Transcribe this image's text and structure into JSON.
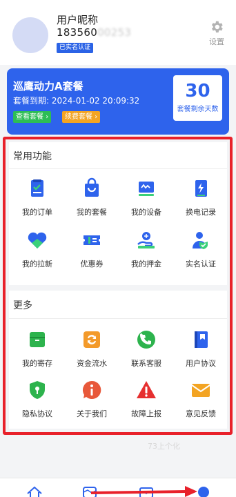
{
  "profile": {
    "nickname": "用户昵称",
    "phone_visible": "183560",
    "phone_obscured": "00253",
    "verified_badge": "已实名认证",
    "settings_label": "设置"
  },
  "package": {
    "name": "巡鹰动力A套餐",
    "expire_text": "套餐到期: 2024-01-02 20:09:32",
    "view_button": "查看套餐",
    "renew_button": "续费套餐",
    "days_remaining": "30",
    "days_label": "套餐剩余天数"
  },
  "common_functions": {
    "title": "常用功能",
    "items": [
      {
        "label": "我的订单",
        "icon": "order-icon"
      },
      {
        "label": "我的套餐",
        "icon": "package-bag-icon"
      },
      {
        "label": "我的设备",
        "icon": "device-icon"
      },
      {
        "label": "换电记录",
        "icon": "battery-swap-icon"
      },
      {
        "label": "我的拉新",
        "icon": "heart-icon"
      },
      {
        "label": "优惠券",
        "icon": "coupon-icon"
      },
      {
        "label": "我的押金",
        "icon": "deposit-icon"
      },
      {
        "label": "实名认证",
        "icon": "user-verify-icon"
      }
    ]
  },
  "more": {
    "title": "更多",
    "items": [
      {
        "label": "我的寄存",
        "icon": "storage-icon"
      },
      {
        "label": "资金流水",
        "icon": "transactions-icon"
      },
      {
        "label": "联系客服",
        "icon": "phone-icon"
      },
      {
        "label": "用户协议",
        "icon": "agreement-icon"
      },
      {
        "label": "隐私协议",
        "icon": "privacy-shield-icon"
      },
      {
        "label": "关于我们",
        "icon": "info-icon"
      },
      {
        "label": "故障上报",
        "icon": "warning-icon"
      },
      {
        "label": "意见反馈",
        "icon": "feedback-mail-icon"
      }
    ]
  },
  "watermark": "73上个化",
  "tabbar": {
    "tabs": [
      {
        "icon": "home-icon"
      },
      {
        "icon": "map-icon"
      },
      {
        "icon": "wallet-icon"
      },
      {
        "icon": "profile-icon"
      }
    ]
  },
  "colors": {
    "brand_blue": "#2e63ec",
    "highlight_red": "#e8212b",
    "green": "#2dbd55",
    "orange": "#f3a423"
  }
}
